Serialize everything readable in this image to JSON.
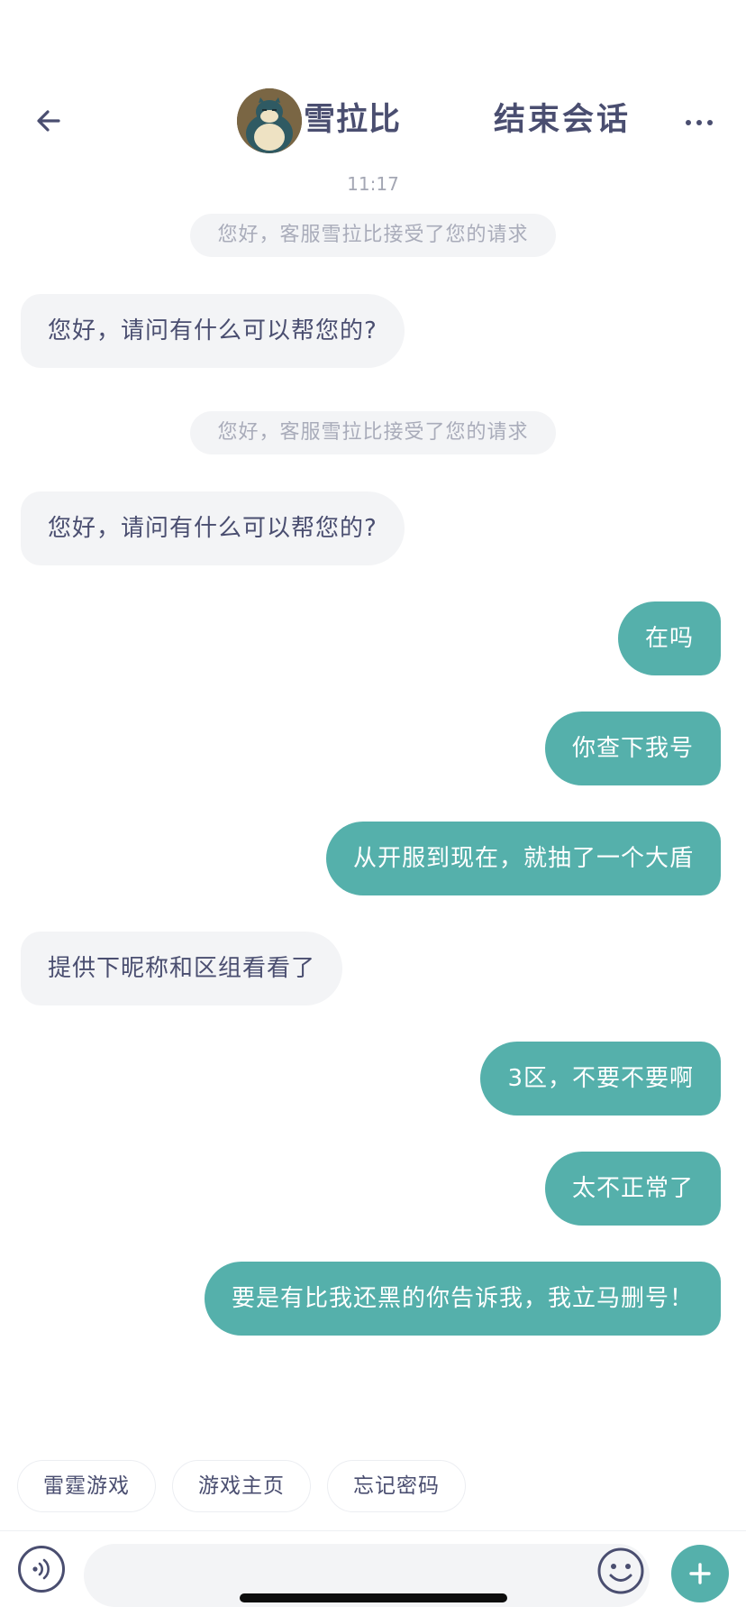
{
  "header": {
    "back_icon": "arrow-left-icon",
    "agent_name": "雪拉比",
    "end_session_label": "结束会话",
    "more_icon": "ellipsis-icon"
  },
  "chat": {
    "timestamp": "11:17",
    "messages": [
      {
        "type": "system",
        "text": "您好，客服雪拉比接受了您的请求"
      },
      {
        "type": "agent",
        "text": "您好，请问有什么可以帮您的?"
      },
      {
        "type": "system",
        "text": "您好，客服雪拉比接受了您的请求"
      },
      {
        "type": "agent",
        "text": "您好，请问有什么可以帮您的?"
      },
      {
        "type": "user",
        "text": "在吗"
      },
      {
        "type": "user",
        "text": "你查下我号"
      },
      {
        "type": "user",
        "text": "从开服到现在，就抽了一个大盾"
      },
      {
        "type": "agent",
        "text": "提供下昵称和区组看看了"
      },
      {
        "type": "user",
        "text": "3区，不要不要啊"
      },
      {
        "type": "user",
        "text": "太不正常了"
      },
      {
        "type": "user",
        "text": "要是有比我还黑的你告诉我，我立马删号！"
      }
    ]
  },
  "quick_replies": [
    "雷霆游戏",
    "游戏主页",
    "忘记密码"
  ],
  "input_bar": {
    "voice_icon": "voice-icon",
    "placeholder": "",
    "emoji_icon": "emoji-icon",
    "plus_icon": "plus-icon"
  },
  "colors": {
    "accent": "#55b0ab",
    "agent_bubble": "#f3f4f6",
    "text": "#4a4e70",
    "muted": "#a4a7b4"
  }
}
